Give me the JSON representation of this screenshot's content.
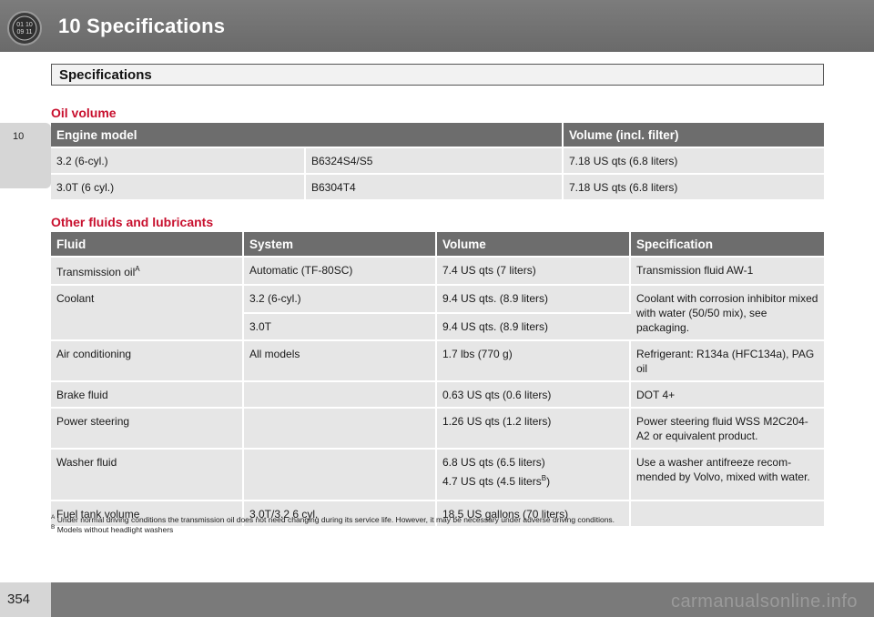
{
  "header": {
    "chapter_title": "10  Specifications",
    "icon": "chapter-badge-icon"
  },
  "chapter_tab": {
    "number": "10"
  },
  "section": {
    "title": "Specifications"
  },
  "oil_volume": {
    "heading": "Oil volume",
    "columns": [
      "Engine model",
      "Volume (incl. filter)"
    ],
    "rows": [
      {
        "engine": "3.2 (6-cyl.)",
        "code": "B6324S4/S5",
        "volume": "7.18 US qts (6.8 liters)"
      },
      {
        "engine": "3.0T (6 cyl.)",
        "code": "B6304T4",
        "volume": "7.18 US qts (6.8 liters)"
      }
    ]
  },
  "fluids": {
    "heading": "Other fluids and lubricants",
    "columns": [
      "Fluid",
      "System",
      "Volume",
      "Specification"
    ],
    "transmission": {
      "fluid": "Transmission oil",
      "fluid_sup": "A",
      "system": "Automatic (TF-80SC)",
      "volume": "7.4 US qts (7 liters)",
      "spec": "Transmission fluid AW-1"
    },
    "coolant": {
      "fluid": "Coolant",
      "system_1": "3.2 (6-cyl.)",
      "volume_1": "9.4 US qts. (8.9 liters)",
      "system_2": "3.0T",
      "volume_2": "9.4 US qts. (8.9 liters)",
      "spec": "Coolant with corrosion inhibitor mixed with water (50/50 mix), see packaging."
    },
    "ac": {
      "fluid": "Air conditioning",
      "system": "All models",
      "volume": "1.7 lbs (770 g)",
      "spec": "Refrigerant: R134a (HFC134a), PAG oil"
    },
    "brake": {
      "fluid": "Brake fluid",
      "volume": "0.63 US qts (0.6 liters)",
      "spec": "DOT 4+"
    },
    "steering": {
      "fluid": "Power steering",
      "volume": "1.26 US qts (1.2 liters)",
      "spec": "Power steering fluid WSS M2C204-A2 or equivalent product."
    },
    "washer": {
      "fluid": "Washer fluid",
      "volume_1": "6.8 US qts (6.5 liters)",
      "volume_2": "4.7 US qts (4.5 liters",
      "volume_2_sup": "B",
      "volume_2_end": ")",
      "spec": "Use a washer antifreeze recom-mended by Volvo, mixed with water."
    },
    "fuel": {
      "fluid": "Fuel tank volume",
      "system": "3.0T/3.2 6 cyl.",
      "volume": "18.5 US gallons (70 liters)"
    }
  },
  "footnotes": {
    "a_mark": "A",
    "a_text": "Under normal driving conditions the transmission oil does not need changing during its service life. However, it may be necessary under adverse driving conditions.",
    "b_mark": "B",
    "b_text": "Models without headlight washers"
  },
  "footer": {
    "page_number": "354",
    "watermark": "carmanualsonline.info"
  }
}
